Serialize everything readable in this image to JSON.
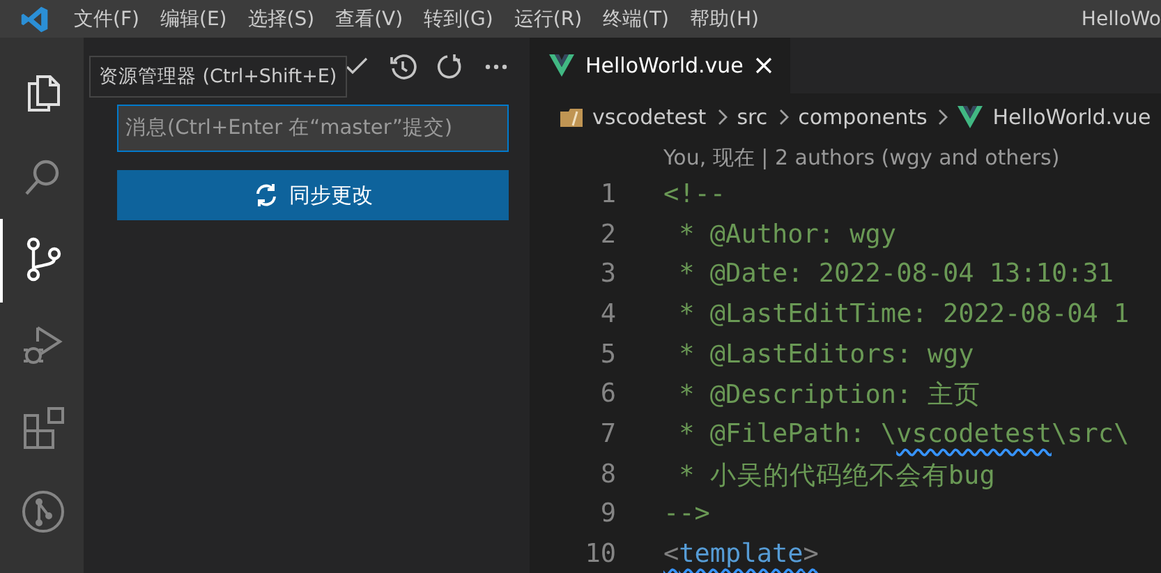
{
  "menu_bar": {
    "items": [
      "文件(F)",
      "编辑(E)",
      "选择(S)",
      "查看(V)",
      "转到(G)",
      "运行(R)",
      "终端(T)",
      "帮助(H)"
    ],
    "title": "HelloWo"
  },
  "activity_bar": {
    "items": [
      {
        "kind": "files",
        "selected": false
      },
      {
        "kind": "search",
        "selected": false
      },
      {
        "kind": "scm",
        "selected": true
      },
      {
        "kind": "debug",
        "selected": false
      },
      {
        "kind": "extensions",
        "selected": false
      },
      {
        "kind": "graph",
        "selected": false
      }
    ]
  },
  "tooltip": "资源管理器 (Ctrl+Shift+E)",
  "commit_message": {
    "placeholder": "消息(Ctrl+Enter 在“master”提交)"
  },
  "sync_button": "同步更改",
  "tabs": [
    {
      "label": "HelloWorld.vue",
      "selected": true
    }
  ],
  "breadcrumb": [
    "vscodetest",
    "src",
    "components",
    "HelloWorld.vue"
  ],
  "codelens": "You, 现在 | 2 authors (wgy and others)",
  "code_lines": [
    {
      "number": "1",
      "segments": [
        {
          "kind": "comment",
          "text": "<!--"
        }
      ]
    },
    {
      "number": "2",
      "segments": [
        {
          "kind": "comment",
          "text": " * @Author: wgy"
        }
      ]
    },
    {
      "number": "3",
      "segments": [
        {
          "kind": "comment",
          "text": " * @Date: 2022-08-04 13:10:31"
        }
      ]
    },
    {
      "number": "4",
      "segments": [
        {
          "kind": "comment",
          "text": " * @LastEditTime: 2022-08-04 1"
        }
      ]
    },
    {
      "number": "5",
      "segments": [
        {
          "kind": "comment",
          "text": " * @LastEditors: wgy"
        }
      ]
    },
    {
      "number": "6",
      "segments": [
        {
          "kind": "comment",
          "text": " * @Description: 主页"
        }
      ]
    },
    {
      "number": "7",
      "segments": [
        {
          "kind": "comment",
          "text": " * @FilePath: \\"
        },
        {
          "kind": "comment-squiggle",
          "text": "vscodetest"
        },
        {
          "kind": "comment",
          "text": "\\src\\"
        }
      ]
    },
    {
      "number": "8",
      "segments": [
        {
          "kind": "comment",
          "text": " * 小吴的代码绝不会有bug"
        }
      ]
    },
    {
      "number": "9",
      "segments": [
        {
          "kind": "comment",
          "text": "-->"
        }
      ]
    },
    {
      "number": "10",
      "segments": [
        {
          "kind": "punct-squiggle",
          "text": "<"
        },
        {
          "kind": "tag-squiggle",
          "text": "template"
        },
        {
          "kind": "punct-squiggle",
          "text": ">"
        }
      ]
    }
  ]
}
